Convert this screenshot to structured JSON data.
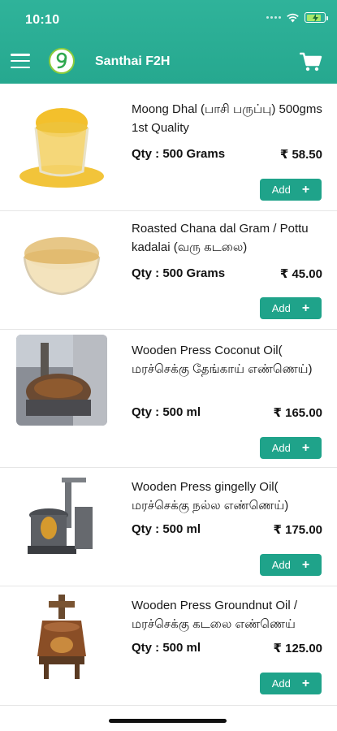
{
  "status_bar": {
    "time": "10:10"
  },
  "header": {
    "title": "Santhai F2H"
  },
  "products": [
    {
      "name": "Moong Dhal (பாசி பருப்பு) 500gms 1st Quality",
      "qty": "Qty : 500 Grams",
      "price": "₹ 58.50",
      "add_label": "Add",
      "image": "moong-dhal"
    },
    {
      "name": "Roasted Chana dal Gram / Pottu kadalai (வரு கடலை)",
      "qty": "Qty : 500 Grams",
      "price": "₹ 45.00",
      "add_label": "Add",
      "image": "chana-dal"
    },
    {
      "name": "Wooden Press Coconut Oil( மரச்செக்கு தேங்காய் எண்ணெய்)",
      "qty": "Qty : 500 ml",
      "price": "₹ 165.00",
      "add_label": "Add",
      "image": "coconut-oil-press"
    },
    {
      "name": "Wooden Press gingelly Oil( மரச்செக்கு நல்ல எண்ணெய்)",
      "qty": "Qty : 500 ml",
      "price": "₹ 175.00",
      "add_label": "Add",
      "image": "gingelly-oil-press"
    },
    {
      "name": "Wooden Press Groundnut Oil / மரச்செக்கு கடலை எண்ணெய்",
      "qty": "Qty : 500 ml",
      "price": "₹ 125.00",
      "add_label": "Add",
      "image": "groundnut-oil-press"
    }
  ],
  "colors": {
    "header": "#26a88f",
    "button": "#1fa38a",
    "logo_ring": "#8ccc3a"
  }
}
